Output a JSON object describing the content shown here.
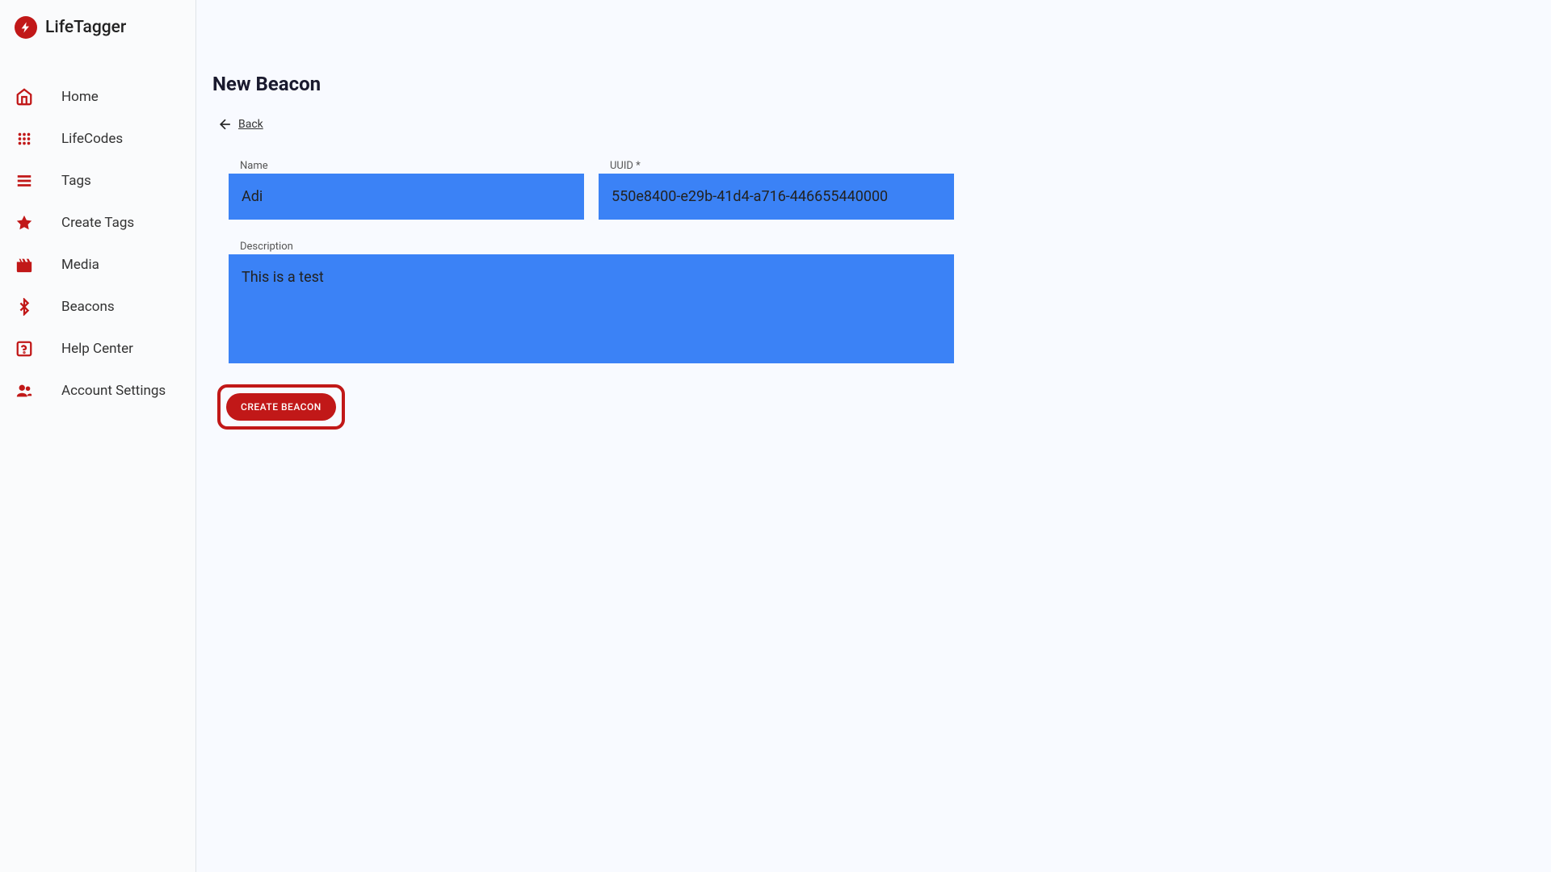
{
  "brand": {
    "name": "LifeTagger"
  },
  "sidebar": {
    "items": [
      {
        "label": "Home",
        "icon": "home"
      },
      {
        "label": "LifeCodes",
        "icon": "dots"
      },
      {
        "label": "Tags",
        "icon": "menu"
      },
      {
        "label": "Create Tags",
        "icon": "star"
      },
      {
        "label": "Media",
        "icon": "movie"
      },
      {
        "label": "Beacons",
        "icon": "bluetooth"
      },
      {
        "label": "Help Center",
        "icon": "help"
      },
      {
        "label": "Account Settings",
        "icon": "people"
      }
    ]
  },
  "page": {
    "title": "New Beacon",
    "back_label": "Back"
  },
  "form": {
    "name_label": "Name",
    "name_value": "Adi",
    "uuid_label": "UUID *",
    "uuid_value": "550e8400-e29b-41d4-a716-446655440000",
    "description_label": "Description",
    "description_value": "This is a test",
    "submit_label": "CREATE BEACON"
  }
}
